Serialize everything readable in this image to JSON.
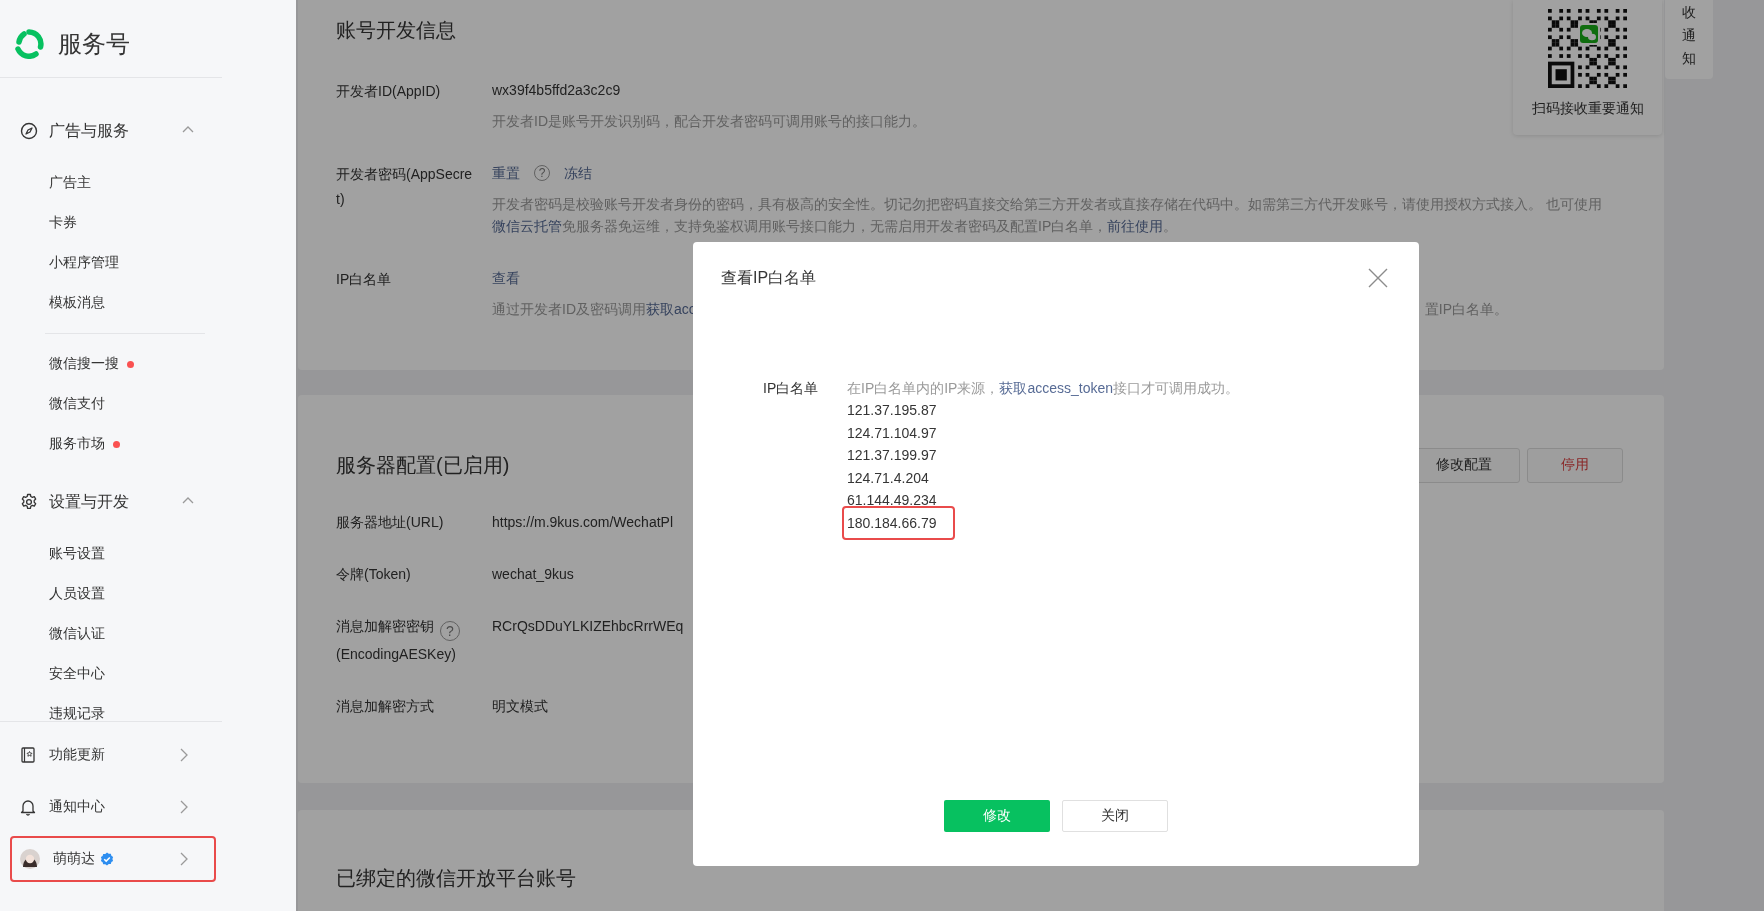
{
  "sidebar": {
    "logo_text": "服务号",
    "sections": [
      {
        "title": "广告与服务",
        "expanded": true,
        "groups": [
          {
            "items": [
              {
                "label": "广告主",
                "dot": false
              },
              {
                "label": "卡券",
                "dot": false
              },
              {
                "label": "小程序管理",
                "dot": false
              },
              {
                "label": "模板消息",
                "dot": false
              }
            ]
          },
          {
            "items": [
              {
                "label": "微信搜一搜",
                "dot": true
              },
              {
                "label": "微信支付",
                "dot": false
              },
              {
                "label": "服务市场",
                "dot": true
              }
            ]
          }
        ]
      },
      {
        "title": "设置与开发",
        "expanded": true,
        "groups": [
          {
            "items": [
              {
                "label": "账号设置",
                "dot": false
              },
              {
                "label": "人员设置",
                "dot": false
              },
              {
                "label": "微信认证",
                "dot": false
              },
              {
                "label": "安全中心",
                "dot": false
              },
              {
                "label": "违规记录",
                "dot": false
              }
            ]
          }
        ]
      }
    ],
    "footer": [
      {
        "label": "功能更新",
        "kind": "link",
        "verified": false,
        "highlighted": false
      },
      {
        "label": "通知中心",
        "kind": "link",
        "verified": false,
        "highlighted": false
      },
      {
        "label": "萌萌达",
        "kind": "user",
        "verified": true,
        "highlighted": true
      }
    ]
  },
  "main": {
    "cards": [
      {
        "title": "账号开发信息",
        "rows": [
          {
            "label": [
              {
                "kind": "text",
                "text": "开发者ID(AppID)"
              }
            ],
            "value": [
              {
                "kind": "text",
                "text": "wx39f4b5ffd2a3c2c9"
              }
            ],
            "desc": [
              [
                {
                  "kind": "text",
                  "text": "开发者ID是账号开发识别码，配合开发者密码可调用账号的接口能力。"
                }
              ]
            ]
          },
          {
            "label": [
              {
                "kind": "text",
                "text": "开发者密码(AppSecret)"
              }
            ],
            "value": [
              {
                "kind": "link",
                "text": "重置"
              },
              {
                "kind": "help",
                "text": "?"
              },
              {
                "kind": "link",
                "text": "冻结"
              }
            ],
            "desc": [
              [
                {
                  "kind": "text",
                  "text": "开发者密码是校验账号开发者身份的密码，具有极高的安全性。切记勿把密码直接交给第三方开发者或直接存储在代码中。如需第三方代开发账号，请使用授权方式接入。 也可使用"
                },
                {
                  "kind": "link",
                  "text": "微信云托管"
                },
                {
                  "kind": "text",
                  "text": "免服务器免运维，支持免鉴权调用账号接口能力，无需启用开发者密码及配置IP白名单，"
                },
                {
                  "kind": "link",
                  "text": "前往使用"
                },
                {
                  "kind": "text",
                  "text": "。"
                }
              ]
            ]
          },
          {
            "label": [
              {
                "kind": "text",
                "text": "IP白名单"
              }
            ],
            "value": [
              {
                "kind": "link",
                "text": "查看"
              }
            ],
            "desc": [
              [
                {
                  "kind": "text",
                  "text": "通过开发者ID及密码调用"
                },
                {
                  "kind": "link",
                  "text": "获取acc"
                }
              ],
              [
                {
                  "kind": "text",
                  "text": "置IP白名单。"
                }
              ]
            ]
          }
        ]
      },
      {
        "title": "服务器配置(已启用)",
        "actions": [
          {
            "label": "修改配置",
            "kind": "default"
          },
          {
            "label": "停用",
            "kind": "danger"
          }
        ],
        "rows": [
          {
            "label": [
              {
                "kind": "text",
                "text": "服务器地址(URL)"
              }
            ],
            "value": [
              {
                "kind": "text",
                "text": "https://m.9kus.com/WechatPl"
              }
            ]
          },
          {
            "label": [
              {
                "kind": "text",
                "text": "令牌(Token)"
              }
            ],
            "value": [
              {
                "kind": "text",
                "text": "wechat_9kus"
              }
            ]
          },
          {
            "label": [
              {
                "kind": "text",
                "text": "消息加解密密钥"
              },
              {
                "kind": "help",
                "text": "?"
              },
              {
                "kind": "break"
              },
              {
                "kind": "text",
                "text": "(EncodingAESKey)"
              }
            ],
            "value": [
              {
                "kind": "text",
                "text": "RCrQsDDuYLKIZEhbcRrrWEq"
              }
            ]
          },
          {
            "label": [
              {
                "kind": "text",
                "text": "消息加解密方式"
              }
            ],
            "value": [
              {
                "kind": "text",
                "text": "明文模式"
              }
            ]
          }
        ]
      },
      {
        "title": "已绑定的微信开放平台账号"
      }
    ],
    "qr_card": {
      "caption": "扫码接收重要通知"
    },
    "side_tab": {
      "text": "收通知"
    }
  },
  "dialog": {
    "title": "查看IP白名单",
    "field_label": "IP白名单",
    "hint": [
      {
        "kind": "text",
        "text": "在IP白名单内的IP来源，"
      },
      {
        "kind": "link",
        "text": "获取access_token"
      },
      {
        "kind": "text",
        "text": "接口才可调用成功。"
      }
    ],
    "ips": [
      {
        "text": "121.37.195.87",
        "highlighted": false
      },
      {
        "text": "124.71.104.97",
        "highlighted": false
      },
      {
        "text": "121.37.199.97",
        "highlighted": false
      },
      {
        "text": "124.71.4.204",
        "highlighted": false
      },
      {
        "text": "61.144.49.234",
        "highlighted": false
      },
      {
        "text": "180.184.66.79",
        "highlighted": true
      }
    ],
    "buttons": [
      {
        "label": "修改",
        "kind": "primary"
      },
      {
        "label": "关闭",
        "kind": "default"
      }
    ]
  }
}
